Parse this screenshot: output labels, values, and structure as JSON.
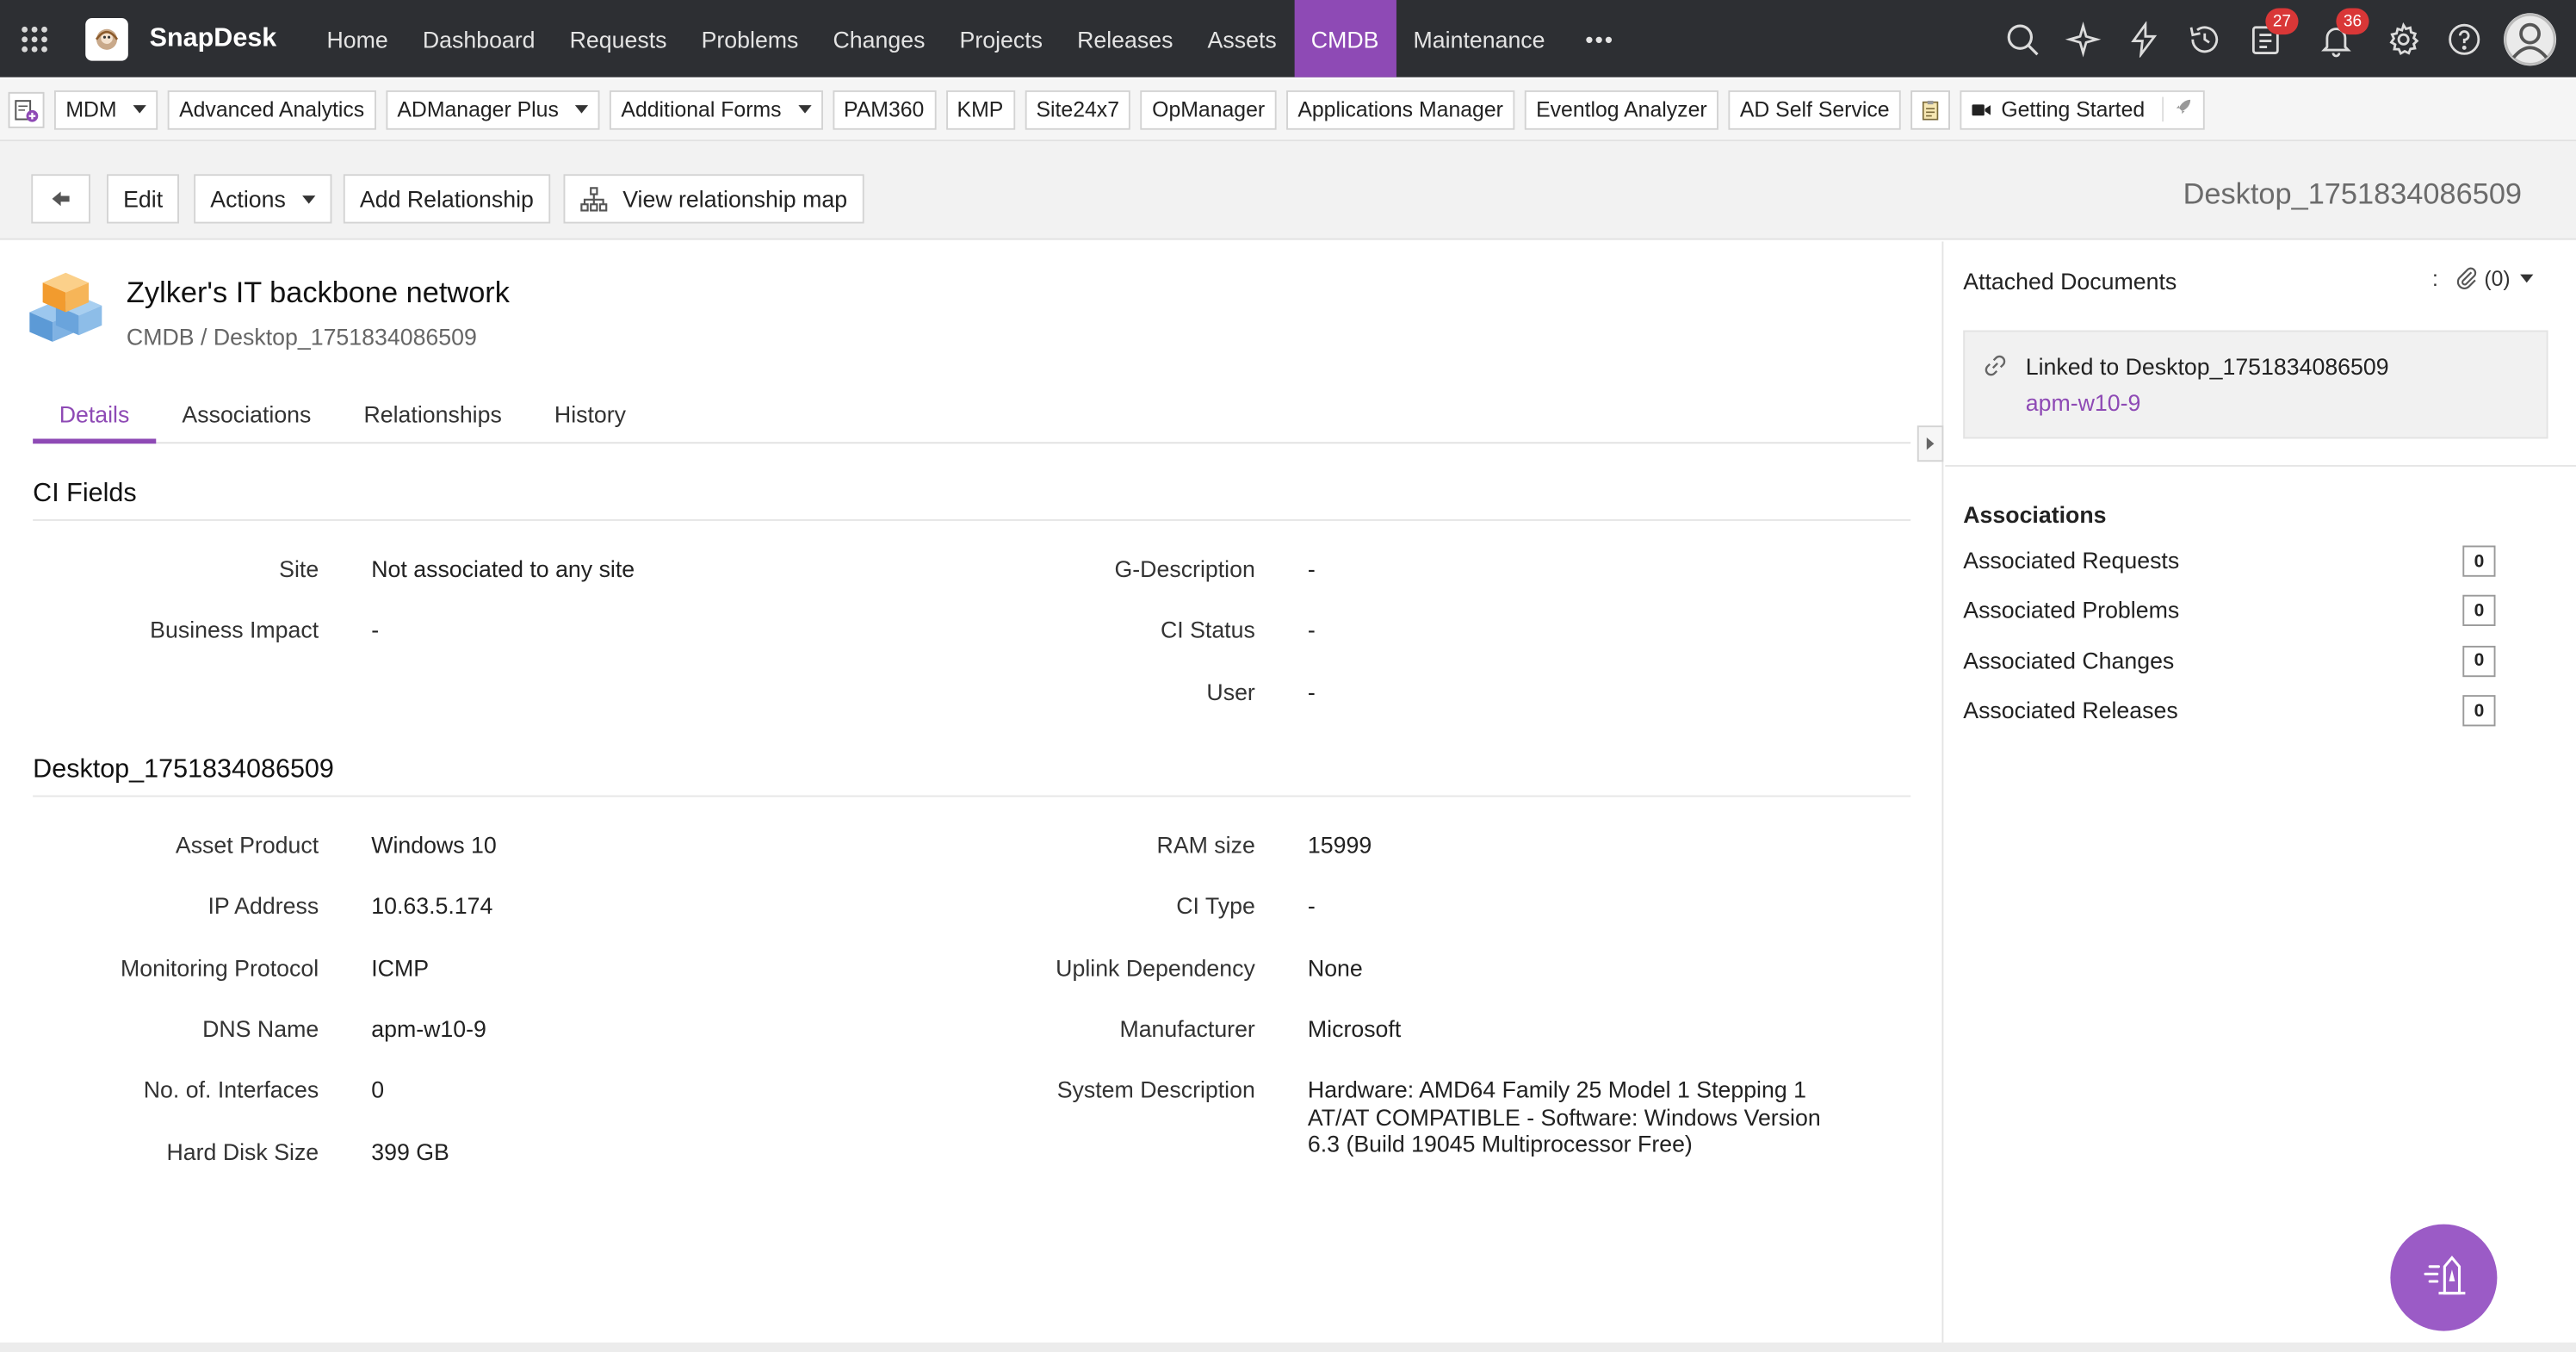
{
  "app": {
    "name": "SnapDesk"
  },
  "nav": {
    "items": [
      "Home",
      "Dashboard",
      "Requests",
      "Problems",
      "Changes",
      "Projects",
      "Releases",
      "Assets",
      "CMDB",
      "Maintenance"
    ],
    "active": "CMDB",
    "more": "•••"
  },
  "top_icons": {
    "tasks_badge": "27",
    "notifications_badge": "36"
  },
  "quickbar": {
    "items": [
      {
        "label": "MDM",
        "dropdown": true
      },
      {
        "label": "Advanced Analytics",
        "dropdown": false
      },
      {
        "label": "ADManager Plus",
        "dropdown": true
      },
      {
        "label": "Additional Forms",
        "dropdown": true
      },
      {
        "label": "PAM360",
        "dropdown": false
      },
      {
        "label": "KMP",
        "dropdown": false
      },
      {
        "label": "Site24x7",
        "dropdown": false
      },
      {
        "label": "OpManager",
        "dropdown": false
      },
      {
        "label": "Applications Manager",
        "dropdown": false
      },
      {
        "label": "Eventlog Analyzer",
        "dropdown": false
      },
      {
        "label": "AD Self Service",
        "dropdown": false
      }
    ],
    "getting_started": "Getting Started"
  },
  "actions": {
    "edit": "Edit",
    "actions": "Actions",
    "add_relationship": "Add Relationship",
    "view_map": "View relationship map"
  },
  "ci": {
    "name": "Desktop_1751834086509",
    "title": "Zylker's IT backbone network",
    "breadcrumb": "CMDB / Desktop_1751834086509"
  },
  "tabs": [
    "Details",
    "Associations",
    "Relationships",
    "History"
  ],
  "active_tab": "Details",
  "ci_fields": {
    "title": "CI Fields",
    "left": [
      {
        "label": "Site",
        "value": "Not associated to any site"
      },
      {
        "label": "Business Impact",
        "value": "-"
      }
    ],
    "right": [
      {
        "label": "G-Description",
        "value": "-"
      },
      {
        "label": "CI Status",
        "value": "-"
      },
      {
        "label": "User",
        "value": "-"
      }
    ]
  },
  "desktop_section": {
    "title": "Desktop_1751834086509",
    "left": [
      {
        "label": "Asset Product",
        "value": "Windows 10"
      },
      {
        "label": "IP Address",
        "value": "10.63.5.174"
      },
      {
        "label": "Monitoring Protocol",
        "value": "ICMP"
      },
      {
        "label": "DNS Name",
        "value": "apm-w10-9"
      },
      {
        "label": "No. of. Interfaces",
        "value": "0"
      },
      {
        "label": "Hard Disk Size",
        "value": "399 GB"
      }
    ],
    "right": [
      {
        "label": "RAM size",
        "value": "15999"
      },
      {
        "label": "CI Type",
        "value": "-"
      },
      {
        "label": "Uplink Dependency",
        "value": "None"
      },
      {
        "label": "Manufacturer",
        "value": "Microsoft"
      },
      {
        "label": "System Description",
        "value": "Hardware: AMD64 Family 25 Model 1 Stepping 1 AT/AT COMPATIBLE - Software: Windows Version 6.3 (Build 19045 Multiprocessor Free)"
      }
    ]
  },
  "right_panel": {
    "attached_title": "Attached Documents",
    "colon": ":",
    "attached_count": "(0)",
    "linked_text": "Linked to Desktop_1751834086509",
    "linked_link": "apm-w10-9",
    "associations_title": "Associations",
    "associations": [
      {
        "label": "Associated Requests",
        "count": "0"
      },
      {
        "label": "Associated Problems",
        "count": "0"
      },
      {
        "label": "Associated Changes",
        "count": "0"
      },
      {
        "label": "Associated Releases",
        "count": "0"
      }
    ]
  },
  "colors": {
    "accent": "#8e4ab5",
    "topbar": "#2d2f33",
    "badge": "#d93737"
  }
}
